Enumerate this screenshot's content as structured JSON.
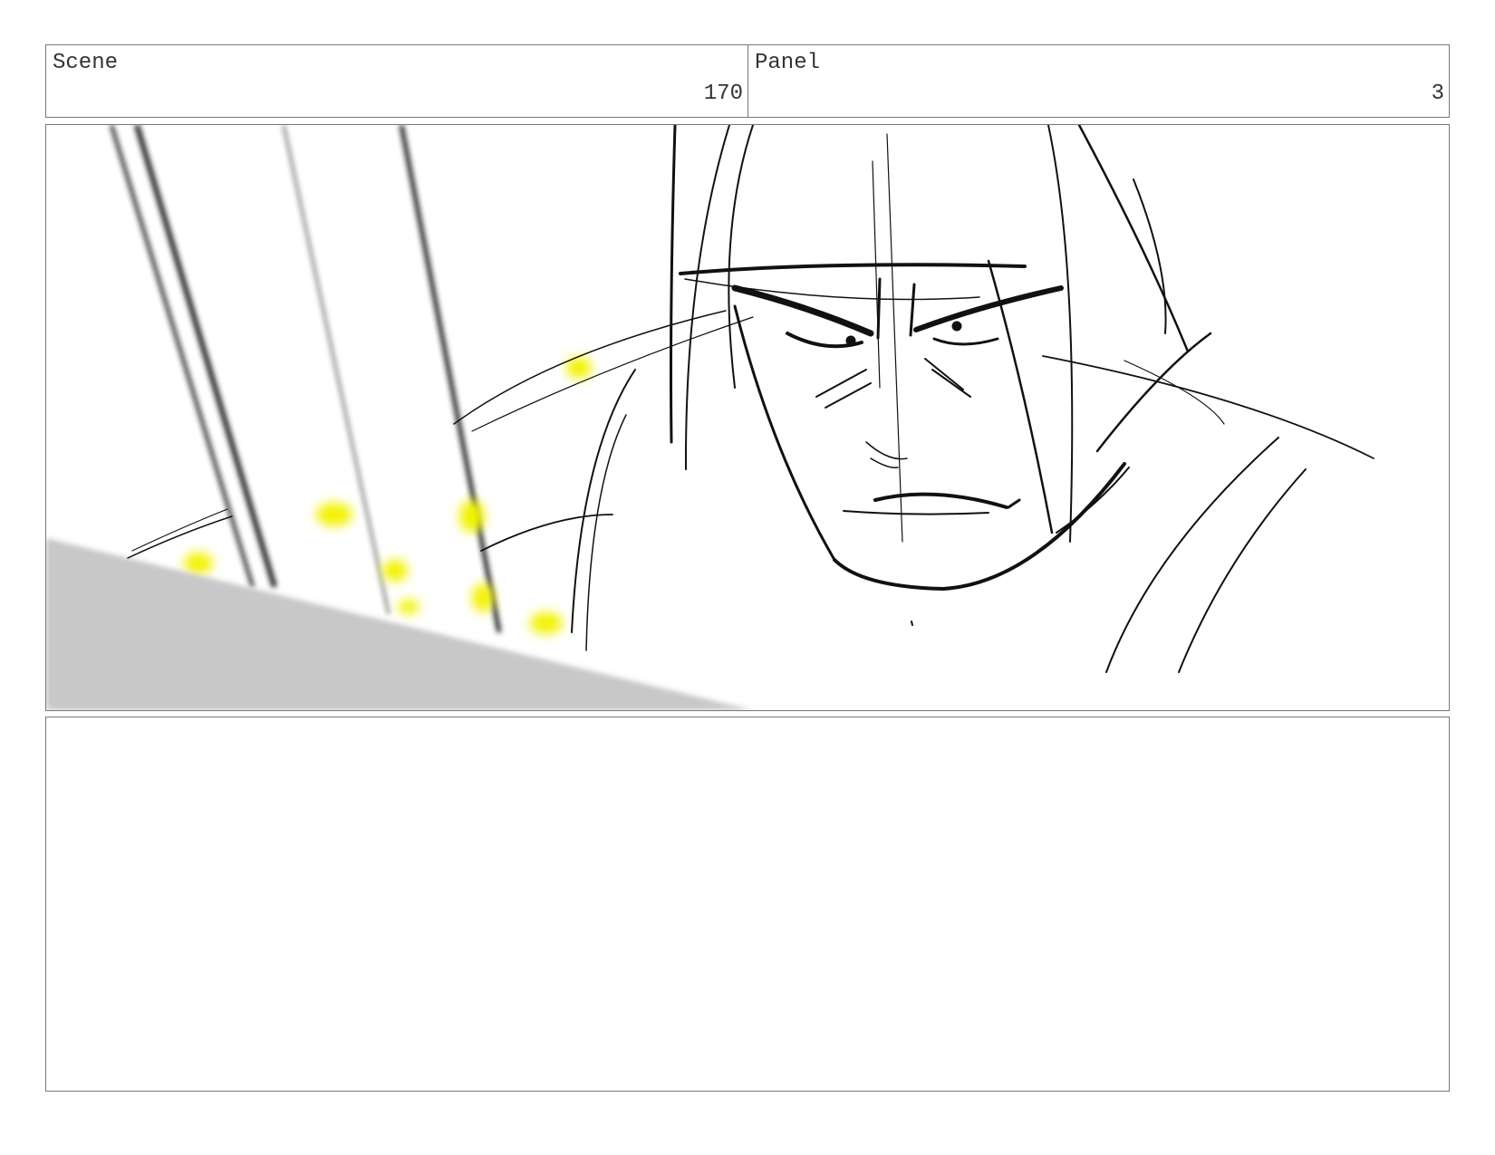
{
  "header": {
    "scene_label": "Scene",
    "scene_number": "170",
    "panel_label": "Panel",
    "panel_number": "3"
  },
  "notes": {
    "text": ""
  },
  "colors": {
    "border": "#777777",
    "sketch_line": "#111111",
    "ground_fill": "#c8c8c8",
    "glow_yellow": "#f2f200"
  }
}
